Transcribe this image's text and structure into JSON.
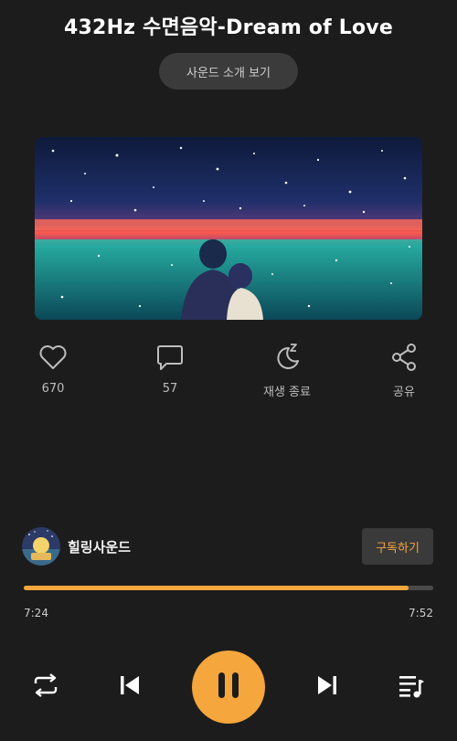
{
  "header": {
    "title": "432Hz 수면음악-Dream of Love",
    "intro_button": "사운드 소개 보기"
  },
  "actions": {
    "like": {
      "icon": "heart-icon",
      "label": "670"
    },
    "comment": {
      "icon": "comment-icon",
      "label": "57"
    },
    "sleep_timer": {
      "icon": "moon-sleep-icon",
      "label": "재생 종료"
    },
    "share": {
      "icon": "share-icon",
      "label": "공유"
    }
  },
  "channel": {
    "name": "힐링사운드",
    "subscribe_label": "구독하기"
  },
  "player": {
    "current_time": "7:24",
    "total_time": "7:52",
    "progress": 0.94
  },
  "colors": {
    "background": "#1c1c1c",
    "accent": "#f5a63c",
    "button_bg": "#3b3b3b",
    "track": "#4a4a4a"
  },
  "controls": {
    "repeat": "repeat-icon",
    "previous": "skip-previous-icon",
    "play_pause": "pause-icon",
    "next": "skip-next-icon",
    "playlist": "playlist-icon"
  }
}
